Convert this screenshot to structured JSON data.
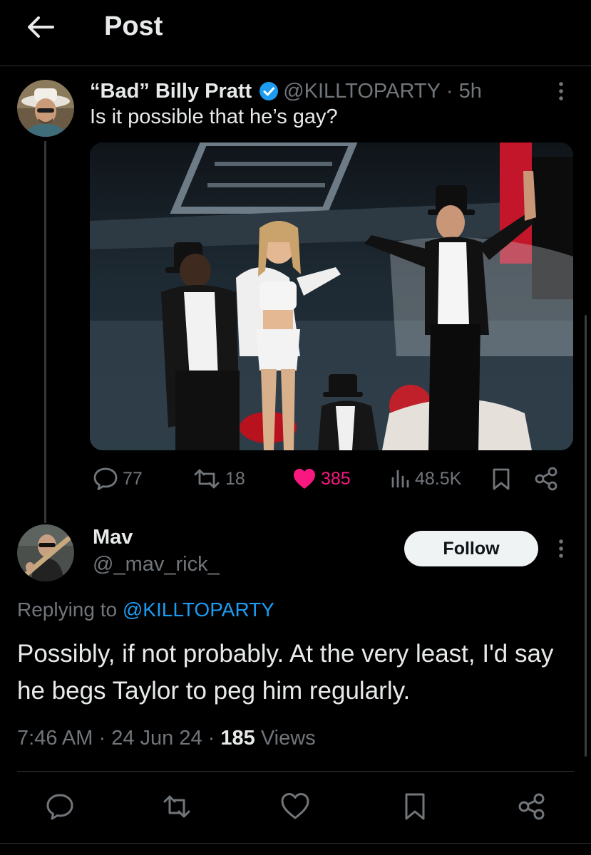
{
  "header": {
    "title": "Post",
    "back_icon": "arrow-left-icon"
  },
  "parent_post": {
    "display_name": "“Bad” Billy Pratt",
    "verified": true,
    "handle": "@KILLTOPARTY",
    "separator": "·",
    "time": "5h",
    "text": "Is it possible that he’s gay?",
    "stats": {
      "replies": "77",
      "reposts": "18",
      "likes": "385",
      "views": "48.5K"
    },
    "liked": true
  },
  "reply_post": {
    "display_name": "Mav",
    "handle": "@_mav_rick_",
    "follow_label": "Follow",
    "replying_prefix": "Replying to",
    "replying_handle": "@KILLTOPARTY",
    "text": "Possibly, if not probably. At the very least, I'd say he begs Taylor to peg him regularly.",
    "time": "7:46 AM",
    "date": "24 Jun 24",
    "views_count": "185",
    "views_label": "Views"
  },
  "colors": {
    "background": "#000000",
    "text_primary": "#e7e9ea",
    "text_secondary": "#71767b",
    "accent_blue": "#1d9bf0",
    "like_pink": "#f91880",
    "divider": "#2f3336"
  }
}
